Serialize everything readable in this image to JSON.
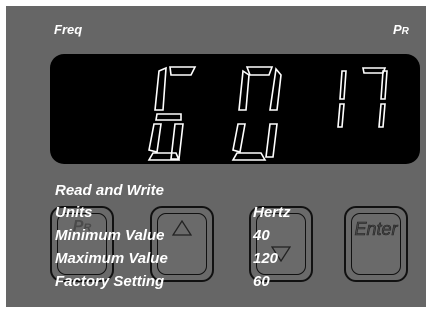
{
  "labels": {
    "freq": "Freq",
    "pr_main": "P",
    "pr_sub": "R"
  },
  "display": {
    "main_value": "60",
    "sub_value": "17"
  },
  "keys": {
    "pr_icon": "pr-key-icon",
    "up_icon": "up-triangle-icon",
    "down_icon": "down-triangle-icon",
    "enter_label": "Enter"
  },
  "info": {
    "access": "Read and Write",
    "rows": [
      {
        "label": "Units",
        "value": "Hertz"
      },
      {
        "label": "Minimum Value",
        "value": "40"
      },
      {
        "label": "Maximum Value",
        "value": "120"
      },
      {
        "label": "Factory Setting",
        "value": "60"
      }
    ]
  },
  "colors": {
    "panel": "#666666",
    "display": "#000000",
    "segment": "#ffffff"
  }
}
